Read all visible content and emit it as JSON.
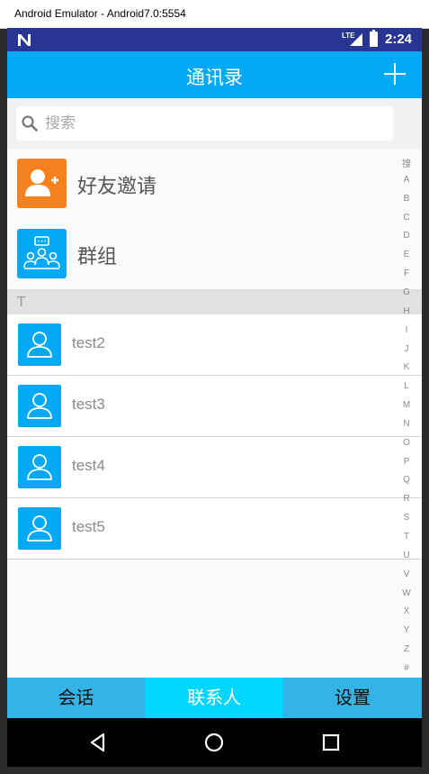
{
  "window": {
    "title": "Android Emulator - Android7.0:5554"
  },
  "status_bar": {
    "network": "LTE",
    "time": "2:24",
    "notification_icon": "n-icon"
  },
  "app_bar": {
    "title": "通讯录",
    "action_icon": "plus-icon"
  },
  "search": {
    "placeholder": "搜索",
    "value": "",
    "icon": "search-icon"
  },
  "fixed_items": [
    {
      "label": "好友邀请",
      "icon": "add-friend-icon",
      "color": "#f5821f"
    },
    {
      "label": "群组",
      "icon": "group-chat-icon",
      "color": "#03a9f4"
    }
  ],
  "section": {
    "letter": "T"
  },
  "contacts": [
    {
      "name": "test2",
      "icon": "user-icon"
    },
    {
      "name": "test3",
      "icon": "user-icon"
    },
    {
      "name": "test4",
      "icon": "user-icon"
    },
    {
      "name": "test5",
      "icon": "user-icon"
    }
  ],
  "index_bar": [
    "搜",
    "A",
    "B",
    "C",
    "D",
    "E",
    "F",
    "G",
    "H",
    "I",
    "J",
    "K",
    "L",
    "M",
    "N",
    "O",
    "P",
    "Q",
    "R",
    "S",
    "T",
    "U",
    "V",
    "W",
    "X",
    "Y",
    "Z",
    "#"
  ],
  "tabs": [
    {
      "label": "会话",
      "active": false
    },
    {
      "label": "联系人",
      "active": true
    },
    {
      "label": "设置",
      "active": false
    }
  ],
  "nav_bar": {
    "buttons": [
      "back-icon",
      "home-icon",
      "recents-icon"
    ]
  },
  "colors": {
    "accent": "#03a9f4",
    "status_bar": "#283593",
    "tab_bar": "#35b3e6",
    "tab_active": "#00d6ff",
    "invite": "#f5821f"
  }
}
